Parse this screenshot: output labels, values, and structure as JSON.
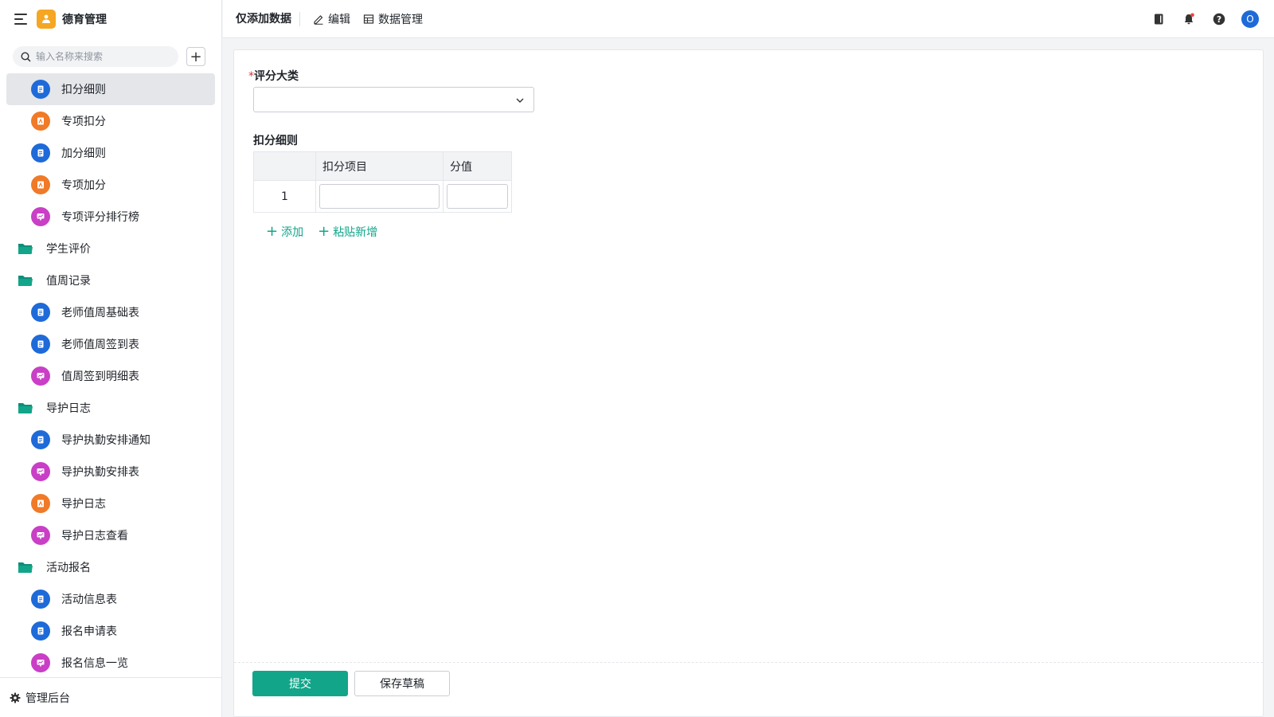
{
  "app": {
    "title": "德育管理"
  },
  "search": {
    "placeholder": "输入名称来搜索"
  },
  "sidebar": {
    "items": [
      {
        "label": "扣分细则",
        "type": "form",
        "indent": true,
        "active": true
      },
      {
        "label": "专项扣分",
        "type": "report",
        "indent": true
      },
      {
        "label": "加分细则",
        "type": "form",
        "indent": true
      },
      {
        "label": "专项加分",
        "type": "report",
        "indent": true
      },
      {
        "label": "专项评分排行榜",
        "type": "dashboard",
        "indent": true
      },
      {
        "label": "学生评价",
        "type": "folder"
      },
      {
        "label": "值周记录",
        "type": "folder"
      },
      {
        "label": "老师值周基础表",
        "type": "form",
        "indent": true
      },
      {
        "label": "老师值周签到表",
        "type": "form",
        "indent": true
      },
      {
        "label": "值周签到明细表",
        "type": "dashboard",
        "indent": true
      },
      {
        "label": "导护日志",
        "type": "folder"
      },
      {
        "label": "导护执勤安排通知",
        "type": "form",
        "indent": true
      },
      {
        "label": "导护执勤安排表",
        "type": "dashboard",
        "indent": true
      },
      {
        "label": "导护日志",
        "type": "report",
        "indent": true
      },
      {
        "label": "导护日志查看",
        "type": "dashboard",
        "indent": true
      },
      {
        "label": "活动报名",
        "type": "folder"
      },
      {
        "label": "活动信息表",
        "type": "form",
        "indent": true
      },
      {
        "label": "报名申请表",
        "type": "form",
        "indent": true
      },
      {
        "label": "报名信息一览",
        "type": "dashboard",
        "indent": true
      }
    ],
    "footer_label": "管理后台"
  },
  "topbar": {
    "title": "仅添加数据",
    "edit_label": "编辑",
    "data_manage_label": "数据管理",
    "avatar_letter": "O"
  },
  "form": {
    "category_label": "评分大类",
    "category_value": "",
    "detail_label": "扣分细则",
    "columns": [
      "",
      "扣分项目",
      "分值"
    ],
    "rows": [
      {
        "index": "1",
        "item": "",
        "score": ""
      }
    ],
    "add_label": "添加",
    "paste_add_label": "粘贴新增",
    "submit_label": "提交",
    "save_draft_label": "保存草稿"
  },
  "colors": {
    "accent": "#12a58a",
    "form_icon": "#1e6ad8",
    "report_icon": "#f07a27",
    "dashboard_icon": "#c93fc6",
    "folder_icon": "#12a58a",
    "logo": "#f5a623"
  }
}
